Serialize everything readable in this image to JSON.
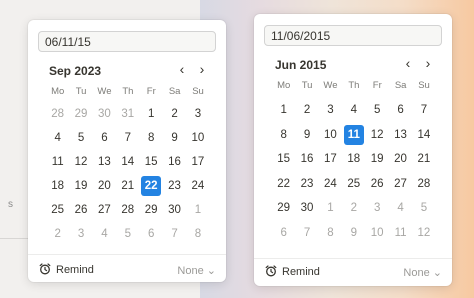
{
  "background": {
    "stub_text": "s"
  },
  "picker_left": {
    "input_value": "06/11/15",
    "month_label": "Sep 2023",
    "weekdays": [
      "Mo",
      "Tu",
      "We",
      "Th",
      "Fr",
      "Sa",
      "Su"
    ],
    "weeks": [
      [
        {
          "d": "28",
          "out": true
        },
        {
          "d": "29",
          "out": true
        },
        {
          "d": "30",
          "out": true
        },
        {
          "d": "31",
          "out": true
        },
        {
          "d": "1"
        },
        {
          "d": "2"
        },
        {
          "d": "3"
        }
      ],
      [
        {
          "d": "4"
        },
        {
          "d": "5"
        },
        {
          "d": "6"
        },
        {
          "d": "7"
        },
        {
          "d": "8"
        },
        {
          "d": "9"
        },
        {
          "d": "10"
        }
      ],
      [
        {
          "d": "11"
        },
        {
          "d": "12"
        },
        {
          "d": "13"
        },
        {
          "d": "14"
        },
        {
          "d": "15"
        },
        {
          "d": "16"
        },
        {
          "d": "17"
        }
      ],
      [
        {
          "d": "18"
        },
        {
          "d": "19"
        },
        {
          "d": "20"
        },
        {
          "d": "21"
        },
        {
          "d": "22",
          "sel": true
        },
        {
          "d": "23"
        },
        {
          "d": "24"
        }
      ],
      [
        {
          "d": "25"
        },
        {
          "d": "26"
        },
        {
          "d": "27"
        },
        {
          "d": "28"
        },
        {
          "d": "29"
        },
        {
          "d": "30"
        },
        {
          "d": "1",
          "out": true
        }
      ],
      [
        {
          "d": "2",
          "out": true
        },
        {
          "d": "3",
          "out": true
        },
        {
          "d": "4",
          "out": true
        },
        {
          "d": "5",
          "out": true
        },
        {
          "d": "6",
          "out": true
        },
        {
          "d": "7",
          "out": true
        },
        {
          "d": "8",
          "out": true
        }
      ]
    ],
    "remind_label": "Remind",
    "remind_value": "None ⌄"
  },
  "picker_right": {
    "input_value": "11/06/2015",
    "month_label": "Jun 2015",
    "weekdays": [
      "Mo",
      "Tu",
      "We",
      "Th",
      "Fr",
      "Sa",
      "Su"
    ],
    "weeks": [
      [
        {
          "d": "1"
        },
        {
          "d": "2"
        },
        {
          "d": "3"
        },
        {
          "d": "4"
        },
        {
          "d": "5"
        },
        {
          "d": "6"
        },
        {
          "d": "7"
        }
      ],
      [
        {
          "d": "8"
        },
        {
          "d": "9"
        },
        {
          "d": "10"
        },
        {
          "d": "11",
          "sel": true
        },
        {
          "d": "12"
        },
        {
          "d": "13"
        },
        {
          "d": "14"
        }
      ],
      [
        {
          "d": "15"
        },
        {
          "d": "16"
        },
        {
          "d": "17"
        },
        {
          "d": "18"
        },
        {
          "d": "19"
        },
        {
          "d": "20"
        },
        {
          "d": "21"
        }
      ],
      [
        {
          "d": "22"
        },
        {
          "d": "23"
        },
        {
          "d": "24"
        },
        {
          "d": "25"
        },
        {
          "d": "26"
        },
        {
          "d": "27"
        },
        {
          "d": "28"
        }
      ],
      [
        {
          "d": "29"
        },
        {
          "d": "30"
        },
        {
          "d": "1",
          "out": true
        },
        {
          "d": "2",
          "out": true
        },
        {
          "d": "3",
          "out": true
        },
        {
          "d": "4",
          "out": true
        },
        {
          "d": "5",
          "out": true
        }
      ],
      [
        {
          "d": "6",
          "out": true
        },
        {
          "d": "7",
          "out": true
        },
        {
          "d": "8",
          "out": true
        },
        {
          "d": "9",
          "out": true
        },
        {
          "d": "10",
          "out": true
        },
        {
          "d": "11",
          "out": true
        },
        {
          "d": "12",
          "out": true
        }
      ]
    ],
    "remind_label": "Remind",
    "remind_value": "None ⌄"
  },
  "icons": {
    "prev": "chevron-left-icon",
    "next": "chevron-right-icon",
    "remind": "alarm-clock-icon"
  },
  "colors": {
    "accent": "#2383e2",
    "text": "#37352f",
    "muted": "#a8a7a4"
  }
}
